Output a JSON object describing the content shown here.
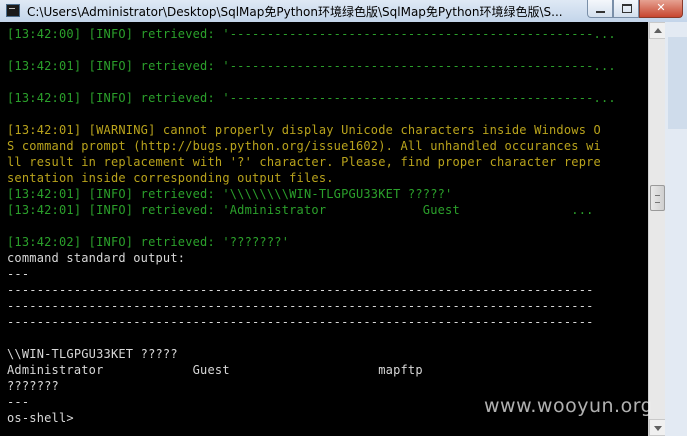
{
  "window": {
    "title": "C:\\Users\\Administrator\\Desktop\\SqlMap免Python环境绿色版\\SqlMap免Python环境绿色版\\S..."
  },
  "console": {
    "lines": [
      {
        "text": "[13:42:00] [INFO] retrieved: '-------------------------------------------------...",
        "color": "green"
      },
      {
        "text": "",
        "color": "green"
      },
      {
        "text": "[13:42:01] [INFO] retrieved: '-------------------------------------------------...",
        "color": "green"
      },
      {
        "text": "",
        "color": "green"
      },
      {
        "text": "[13:42:01] [INFO] retrieved: '-------------------------------------------------...",
        "color": "green"
      },
      {
        "text": "",
        "color": "green"
      },
      {
        "text": "[13:42:01] [WARNING] cannot properly display Unicode characters inside Windows O",
        "color": "yellow"
      },
      {
        "text": "S command prompt (http://bugs.python.org/issue1602). All unhandled occurances wi",
        "color": "yellow"
      },
      {
        "text": "ll result in replacement with '?' character. Please, find proper character repre",
        "color": "yellow"
      },
      {
        "text": "sentation inside corresponding output files.",
        "color": "yellow"
      },
      {
        "text": "[13:42:01] [INFO] retrieved: '\\\\\\\\\\\\\\\\WIN-TLGPGU33KET ?????'",
        "color": "green"
      },
      {
        "text": "[13:42:01] [INFO] retrieved: 'Administrator             Guest               ...",
        "color": "green"
      },
      {
        "text": "",
        "color": "green"
      },
      {
        "text": "[13:42:02] [INFO] retrieved: '???????'",
        "color": "green"
      },
      {
        "text": "command standard output:",
        "color": "white"
      },
      {
        "text": "---",
        "color": "white"
      },
      {
        "text": "-------------------------------------------------------------------------------",
        "color": "white"
      },
      {
        "text": "-------------------------------------------------------------------------------",
        "color": "white"
      },
      {
        "text": "-------------------------------------------------------------------------------",
        "color": "white"
      },
      {
        "text": "",
        "color": "white"
      },
      {
        "text": "\\\\WIN-TLGPGU33KET ?????",
        "color": "white"
      },
      {
        "text": "Administrator            Guest                    mapftp",
        "color": "white"
      },
      {
        "text": "???????",
        "color": "white"
      },
      {
        "text": "---",
        "color": "white"
      },
      {
        "text": "os-shell>",
        "color": "white"
      }
    ]
  },
  "watermark": "www.wooyun.org",
  "colors": {
    "console_bg": "#000000",
    "info_text": "#2ba02b",
    "warning_text": "#b9a31c",
    "output_text": "#d8d8d8"
  }
}
